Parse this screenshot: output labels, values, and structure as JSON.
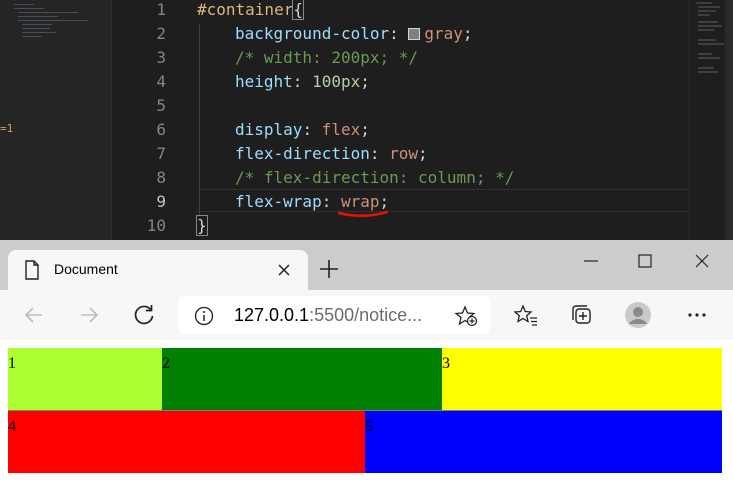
{
  "editor": {
    "left_marker": "=1",
    "line_numbers": [
      "1",
      "2",
      "3",
      "4",
      "5",
      "6",
      "7",
      "8",
      "9",
      "10"
    ],
    "lines": {
      "l1_selector": "#container",
      "l1_brace": "{",
      "l2_prop": "background-color",
      "l2_val": "gray",
      "l3_comment": "/* width: 200px; */",
      "l4_prop": "height",
      "l4_val": "100px",
      "l6_prop": "display",
      "l6_val": "flex",
      "l7_prop": "flex-direction",
      "l7_val": "row",
      "l8_comment": "/* flex-direction: column; */",
      "l9_prop": "flex-wrap",
      "l9_val": "wrap",
      "l10_brace": "}"
    },
    "colors": {
      "background": "#1e1e1e",
      "selector": "#d7ba7d",
      "property": "#9cdcfe",
      "value": "#ce9178",
      "number": "#b5cea8",
      "comment": "#6a9955",
      "underline": "#e51400"
    }
  },
  "browser": {
    "tab": {
      "title": "Document",
      "icon": "document-icon",
      "close_icon": "close-icon"
    },
    "new_tab_icon": "plus-icon",
    "window_controls": [
      "minimize-icon",
      "maximize-icon",
      "close-icon"
    ],
    "toolbar": {
      "back_icon": "arrow-left-icon",
      "forward_icon": "arrow-right-icon",
      "refresh_icon": "refresh-icon",
      "url_host": "127.0.0.1",
      "url_rest": ":5500/notice...",
      "favorites_icon": "star-list-icon",
      "collections_icon": "collections-icon",
      "profile_icon": "avatar-icon",
      "menu_icon": "more-icon"
    }
  },
  "page": {
    "boxes": [
      {
        "label": "1",
        "color": "#adff2f",
        "width": 154
      },
      {
        "label": "2",
        "color": "#008000",
        "width": 280
      },
      {
        "label": "3",
        "color": "#ffff00",
        "width": 280
      },
      {
        "label": "4",
        "color": "#ff0000",
        "width": 357
      },
      {
        "label": "5",
        "color": "#0000ff",
        "width": 357
      }
    ]
  }
}
